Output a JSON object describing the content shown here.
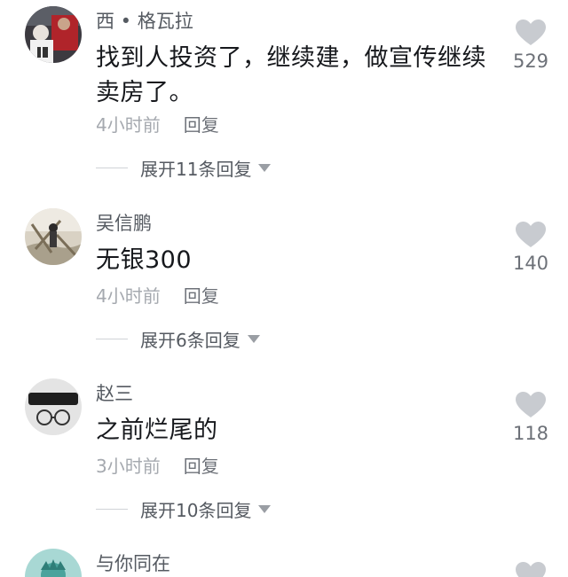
{
  "comments": [
    {
      "username": "西 • 格瓦拉",
      "text": "找到人投资了，继续建，做宣传继续卖房了。",
      "time": "4小时前",
      "reply_label": "回复",
      "expand_label": "展开11条回复",
      "likes": "529"
    },
    {
      "username": "吴信鹏",
      "text": "无银300",
      "time": "4小时前",
      "reply_label": "回复",
      "expand_label": "展开6条回复",
      "likes": "140"
    },
    {
      "username": "赵三",
      "text": "之前烂尾的",
      "time": "3小时前",
      "reply_label": "回复",
      "expand_label": "展开10条回复",
      "likes": "118"
    },
    {
      "username": "与你同在",
      "text": "",
      "time": "",
      "reply_label": "",
      "expand_label": "",
      "likes": ""
    }
  ],
  "colors": {
    "heart": "#c8cbd0",
    "username": "#555a61",
    "text": "#16181c",
    "meta": "#a5a9af"
  },
  "icons": {
    "like": "heart-icon",
    "expand": "caret-down-icon"
  }
}
